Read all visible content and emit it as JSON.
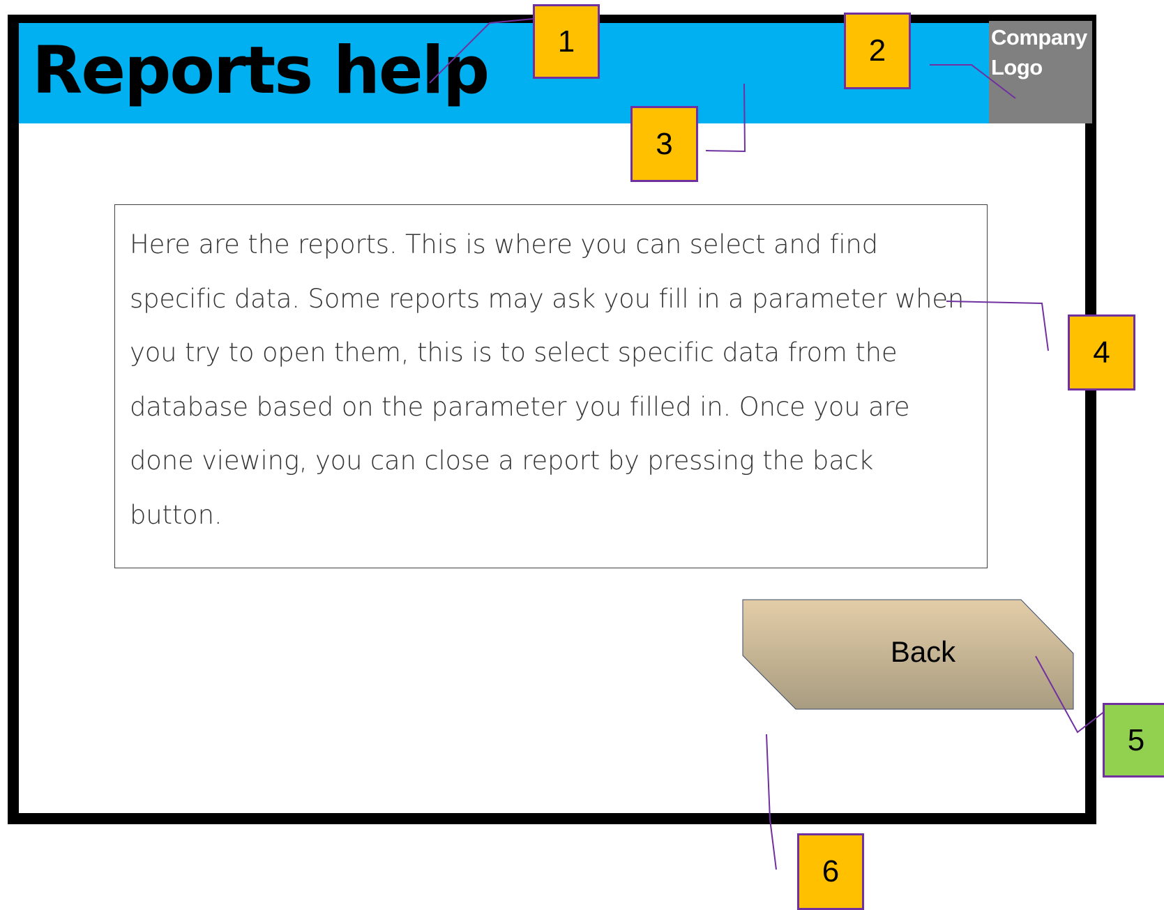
{
  "header": {
    "title": "Reports help",
    "logo_text": "Company Logo",
    "background_color": "#00b0f0"
  },
  "help": {
    "text": "Here are the reports. This is where you can select and find specific data. Some reports may ask you fill in a parameter when you try to open them, this is to select specific data from the database based on the parameter you filled in. Once you are done viewing, you can close a report by pressing the back button."
  },
  "back_button": {
    "label": "Back"
  },
  "callouts": [
    {
      "label": "1",
      "color": "#ffc000"
    },
    {
      "label": "2",
      "color": "#ffc000"
    },
    {
      "label": "3",
      "color": "#ffc000"
    },
    {
      "label": "4",
      "color": "#ffc000"
    },
    {
      "label": "5",
      "color": "#92d050"
    },
    {
      "label": "6",
      "color": "#ffc000"
    }
  ],
  "colors": {
    "frame": "#000000",
    "logo_box": "#808080",
    "leader_line": "#7030a0",
    "button_top": "#e3cda8",
    "button_bottom": "#a89c80"
  }
}
